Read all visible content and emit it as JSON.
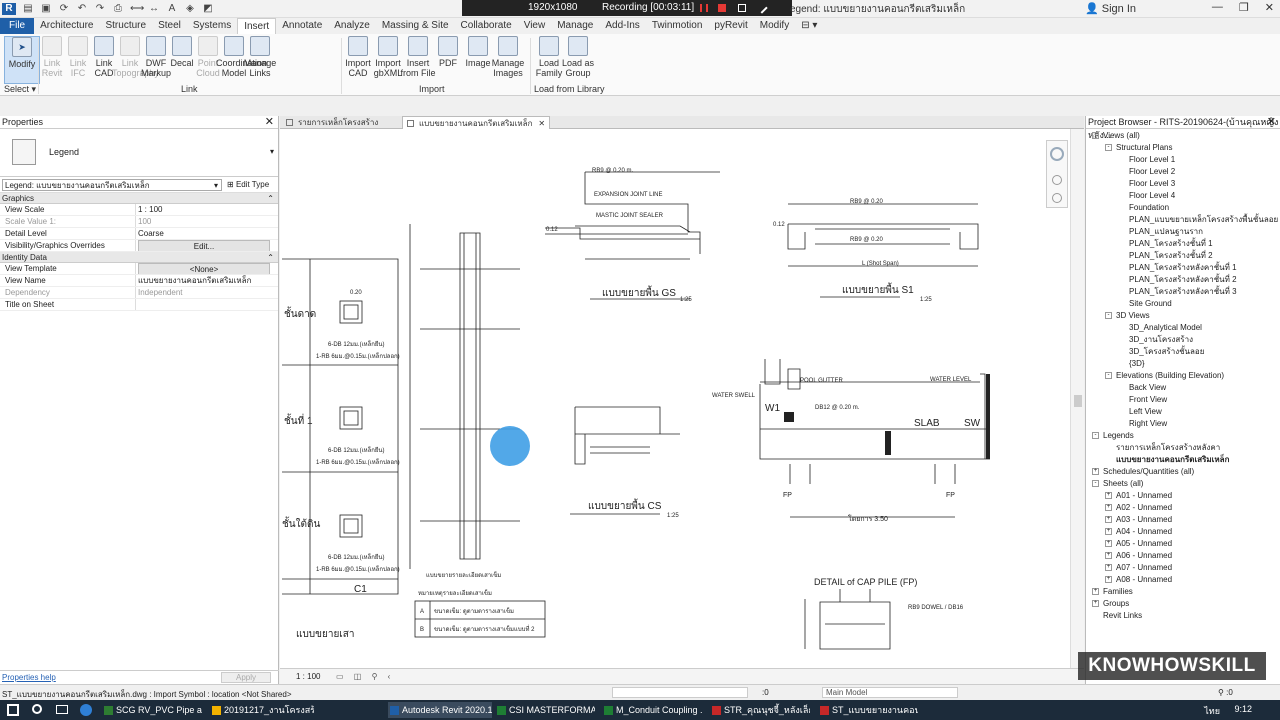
{
  "window": {
    "title_partial": "egend: แบบขยายงานคอนกรีตเสริมเหล็ก",
    "sign_in": "Sign In",
    "recorder": {
      "resolution": "1920x1080",
      "status": "Recording [00:03:11]"
    }
  },
  "ribbon_tabs": [
    "File",
    "Architecture",
    "Structure",
    "Steel",
    "Systems",
    "Insert",
    "Annotate",
    "Analyze",
    "Massing & Site",
    "Collaborate",
    "View",
    "Manage",
    "Add-Ins",
    "Twinmotion",
    "pyRevit",
    "Modify"
  ],
  "active_tab": "Insert",
  "ribbon": {
    "modify": "Modify",
    "select": "Select",
    "link_buttons": [
      {
        "label": "Link\nRevit",
        "dim": true
      },
      {
        "label": "Link\nIFC",
        "dim": true
      },
      {
        "label": "Link\nCAD",
        "dim": false
      },
      {
        "label": "Link\nTopography",
        "dim": true
      },
      {
        "label": "DWF\nMarkup",
        "dim": false
      },
      {
        "label": "Decal",
        "dim": false
      },
      {
        "label": "Point\nCloud",
        "dim": true
      },
      {
        "label": "Coordination\nModel",
        "dim": false
      },
      {
        "label": "Manage\nLinks",
        "dim": false
      }
    ],
    "import_buttons": [
      {
        "label": "Import\nCAD",
        "dim": false
      },
      {
        "label": "Import\ngbXML",
        "dim": false
      },
      {
        "label": "Insert\nfrom File",
        "dim": false
      },
      {
        "label": "PDF",
        "dim": false
      },
      {
        "label": "Image",
        "dim": false
      },
      {
        "label": "Manage\nImages",
        "dim": false
      }
    ],
    "library_buttons": [
      {
        "label": "Load\nFamily",
        "dim": false
      },
      {
        "label": "Load as\nGroup",
        "dim": false
      }
    ],
    "panel_labels": {
      "link": "Link",
      "import": "Import",
      "library": "Load from Library"
    }
  },
  "properties": {
    "header": "Properties",
    "type_name": "Legend",
    "instance_selector": "Legend: แบบขยายงานคอนกรีตเสริมเหล็ก",
    "edit_type": "Edit Type",
    "groups": [
      {
        "name": "Graphics",
        "rows": [
          {
            "key": "View Scale",
            "value": "1 : 100",
            "grey": false
          },
          {
            "key": "Scale Value    1:",
            "value": "100",
            "grey": true
          },
          {
            "key": "Detail Level",
            "value": "Coarse",
            "grey": false
          },
          {
            "key": "Visibility/Graphics Overrides",
            "value": "Edit...",
            "grey": false,
            "button": true
          }
        ]
      },
      {
        "name": "Identity Data",
        "rows": [
          {
            "key": "View Template",
            "value": "<None>",
            "grey": false,
            "button": true
          },
          {
            "key": "View Name",
            "value": "แบบขยายงานคอนกรีตเสริมเหล็ก",
            "grey": false
          },
          {
            "key": "Dependency",
            "value": "Independent",
            "grey": true
          },
          {
            "key": "Title on Sheet",
            "value": "",
            "grey": false
          }
        ]
      }
    ],
    "help": "Properties help",
    "apply": "Apply"
  },
  "view_tabs": [
    {
      "label": "รายการเหล็กโครงสร้างหลังคา",
      "active": false
    },
    {
      "label": "แบบขยายงานคอนกรีตเสริมเหล็ก",
      "active": true
    }
  ],
  "drawing": {
    "texts": {
      "rb9": "RB9 @ 0.20 m.",
      "expansion": "EXPANSION JOINT LINE",
      "mastic": "MASTIC JOINT SEALER",
      "gs_title": "แบบขยายพื้น GS",
      "s1_title": "แบบขยายพื้น S1",
      "cs_title": "แบบขยายพื้น CS",
      "scale_label": "1:25",
      "rb9_s1_top": "RB9 @ 0.20",
      "rb9_s1_bot": "RB9 @ 0.20",
      "l_shot": "L (Shot Span)",
      "dim_012": "0.12",
      "dim_020": "0.20",
      "col_labels": [
        "ชั้นดาด",
        "ชั้นที่ 1",
        "ชั้นใต้ดิน"
      ],
      "col_name": "C1",
      "stirrup": "6-DB 12มม.(เหล็กยืน)",
      "tie": "1-RB 6มม.@0.15ม.(เหล็กปลอก)",
      "col_title": "แบบขยายเสา",
      "pile_title": "แบบขยายรายละเอียดเสาเข็ม",
      "table_title": "หมายเหตุรายละเอียดเสาเข็ม",
      "table_rows": [
        "ขนาดเข็ม: ดูตามตารางเสาเข็ม",
        "ขนาดเข็ม: ดูตามตารางเสาเข็มแบบที่ 2"
      ],
      "table_nums": [
        "A",
        "B"
      ],
      "pool_gutter": "POOL GUTTER",
      "water_level": "WATER LEVEL",
      "water_swell": "WATER SWELL",
      "slab": "SLAB",
      "sw": "SW",
      "w1": "W1",
      "fp": "FP",
      "span": "โดยการ 3.50",
      "db12": "DB12 @ 0.20 m.",
      "cap_title": "DETAIL of CAP PILE (FP)",
      "cap_note": "RB9 DOWEL / DB16",
      "view_scale": "1 : 100"
    }
  },
  "project_browser": {
    "header": "Project Browser - RITS-20190624-(บ้านคุณหญิงหลัง...",
    "tree": [
      {
        "label": "Views (all)",
        "level": 0,
        "toggle": "-"
      },
      {
        "label": "Structural Plans",
        "level": 1,
        "toggle": "-"
      },
      {
        "label": "Floor Level 1",
        "level": 2
      },
      {
        "label": "Floor Level 2",
        "level": 2
      },
      {
        "label": "Floor Level 3",
        "level": 2
      },
      {
        "label": "Floor Level 4",
        "level": 2
      },
      {
        "label": "Foundation",
        "level": 2
      },
      {
        "label": "PLAN_แบบขยายเหล็กโครงสร้างพื้นชั้นลอย",
        "level": 2
      },
      {
        "label": "PLAN_แปลนฐานราก",
        "level": 2
      },
      {
        "label": "PLAN_โครงสร้างชั้นที่ 1",
        "level": 2
      },
      {
        "label": "PLAN_โครงสร้างชั้นที่ 2",
        "level": 2
      },
      {
        "label": "PLAN_โครงสร้างหลังคาชั้นที่ 1",
        "level": 2
      },
      {
        "label": "PLAN_โครงสร้างหลังคาชั้นที่ 2",
        "level": 2
      },
      {
        "label": "PLAN_โครงสร้างหลังคาชั้นที่ 3",
        "level": 2
      },
      {
        "label": "Site Ground",
        "level": 2
      },
      {
        "label": "3D Views",
        "level": 1,
        "toggle": "-"
      },
      {
        "label": "3D_Analytical Model",
        "level": 2
      },
      {
        "label": "3D_งานโครงสร้าง",
        "level": 2
      },
      {
        "label": "3D_โครงสร้างชั้นลอย",
        "level": 2
      },
      {
        "label": "{3D}",
        "level": 2
      },
      {
        "label": "Elevations (Building Elevation)",
        "level": 1,
        "toggle": "-"
      },
      {
        "label": "Back View",
        "level": 2
      },
      {
        "label": "Front View",
        "level": 2
      },
      {
        "label": "Left View",
        "level": 2
      },
      {
        "label": "Right View",
        "level": 2
      },
      {
        "label": "Legends",
        "level": 0,
        "toggle": "-"
      },
      {
        "label": "รายการเหล็กโครงสร้างหลังคา",
        "level": 1
      },
      {
        "label": "แบบขยายงานคอนกรีตเสริมเหล็ก",
        "level": 1,
        "selected": true
      },
      {
        "label": "Schedules/Quantities (all)",
        "level": 0,
        "toggle": "+"
      },
      {
        "label": "Sheets (all)",
        "level": 0,
        "toggle": "-"
      },
      {
        "label": "A01 - Unnamed",
        "level": 1,
        "toggle": "+"
      },
      {
        "label": "A02 - Unnamed",
        "level": 1,
        "toggle": "+"
      },
      {
        "label": "A03 - Unnamed",
        "level": 1,
        "toggle": "+"
      },
      {
        "label": "A04 - Unnamed",
        "level": 1,
        "toggle": "+"
      },
      {
        "label": "A05 - Unnamed",
        "level": 1,
        "toggle": "+"
      },
      {
        "label": "A06 - Unnamed",
        "level": 1,
        "toggle": "+"
      },
      {
        "label": "A07 - Unnamed",
        "level": 1,
        "toggle": "+"
      },
      {
        "label": "A08 - Unnamed",
        "level": 1,
        "toggle": "+"
      },
      {
        "label": "Families",
        "level": 0,
        "toggle": "+"
      },
      {
        "label": "Groups",
        "level": 0,
        "toggle": "+"
      },
      {
        "label": "Revit Links",
        "level": 0
      }
    ]
  },
  "status_bar": {
    "message": "ST_แบบขยายงานคอนกรีตเสริมเหล็ก.dwg : Import Symbol : location <Not Shared>",
    "zero": ":0",
    "model": "Main Model",
    "filter": ":0"
  },
  "taskbar": {
    "items": [
      {
        "label": "SCG RV_PVC Pipe and...",
        "color": "#2e7d32",
        "active": false
      },
      {
        "label": "20191217_งานโครงสร้าง",
        "color": "#f2b200",
        "active": false
      },
      {
        "label": "Autodesk Revit 2020.1...",
        "color": "#1f5fa8",
        "active": true
      },
      {
        "label": "CSI MASTERFORMAT ...",
        "color": "#1e7e34",
        "active": false
      },
      {
        "label": "M_Conduit Coupling ...",
        "color": "#1e7e34",
        "active": false
      },
      {
        "label": "STR_คุณนุชจี้_หลังเล็กค...",
        "color": "#c62828",
        "active": false
      },
      {
        "label": "ST_แบบขยายงานคอนกรีต...",
        "color": "#c62828",
        "active": false
      }
    ],
    "lang": "ไทย",
    "time": "9:12"
  },
  "watermark": "KNOWHOWSKILL"
}
